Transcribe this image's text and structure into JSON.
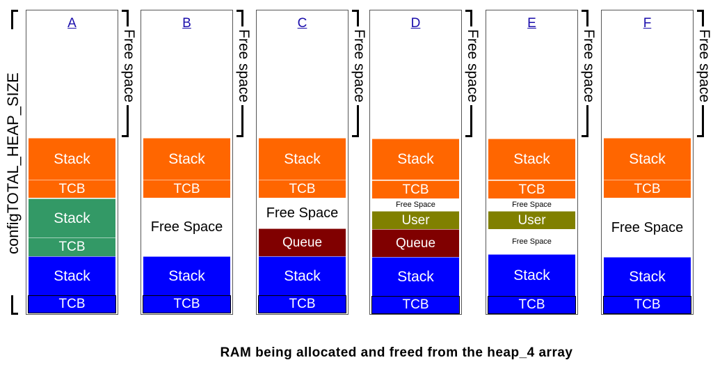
{
  "axis_label": "configTOTAL_HEAP_SIZE",
  "free_space_bracket_label": "Free space",
  "caption": "RAM being allocated and freed from the heap_4 array",
  "colors": {
    "task_orange": "#ff6600",
    "task_green": "#339966",
    "task_blue": "#0000ff",
    "queue": "#800000",
    "user": "#808000"
  },
  "columns": [
    {
      "label": "A",
      "blocks": [
        {
          "text": "Stack",
          "kind": "stack",
          "color": "#ff6600"
        },
        {
          "text": "TCB",
          "kind": "tcb",
          "color": "#ff6600"
        },
        {
          "text": "Stack",
          "kind": "stack",
          "color": "#339966"
        },
        {
          "text": "TCB",
          "kind": "tcb",
          "color": "#339966"
        },
        {
          "text": "Stack",
          "kind": "stack",
          "color": "#0000ff"
        },
        {
          "text": "TCB",
          "kind": "tcb",
          "color": "#0000ff"
        }
      ]
    },
    {
      "label": "B",
      "blocks": [
        {
          "text": "Stack",
          "kind": "stack",
          "color": "#ff6600"
        },
        {
          "text": "TCB",
          "kind": "tcb",
          "color": "#ff6600"
        },
        {
          "text": "Free Space",
          "kind": "free",
          "color": "#ffffff"
        },
        {
          "text": "Stack",
          "kind": "stack",
          "color": "#0000ff"
        },
        {
          "text": "TCB",
          "kind": "tcb",
          "color": "#0000ff"
        }
      ]
    },
    {
      "label": "C",
      "blocks": [
        {
          "text": "Stack",
          "kind": "stack",
          "color": "#ff6600"
        },
        {
          "text": "TCB",
          "kind": "tcb",
          "color": "#ff6600"
        },
        {
          "text": "Free Space",
          "kind": "free",
          "color": "#ffffff"
        },
        {
          "text": "Queue",
          "kind": "queue",
          "color": "#800000"
        },
        {
          "text": "Stack",
          "kind": "stack",
          "color": "#0000ff"
        },
        {
          "text": "TCB",
          "kind": "tcb",
          "color": "#0000ff"
        }
      ]
    },
    {
      "label": "D",
      "blocks": [
        {
          "text": "Stack",
          "kind": "stack",
          "color": "#ff6600"
        },
        {
          "text": "TCB",
          "kind": "tcb",
          "color": "#ff6600"
        },
        {
          "text": "Free Space",
          "kind": "free",
          "color": "#ffffff"
        },
        {
          "text": "User",
          "kind": "user",
          "color": "#808000"
        },
        {
          "text": "Queue",
          "kind": "queue",
          "color": "#800000"
        },
        {
          "text": "Stack",
          "kind": "stack",
          "color": "#0000ff"
        },
        {
          "text": "TCB",
          "kind": "tcb",
          "color": "#0000ff"
        }
      ]
    },
    {
      "label": "E",
      "blocks": [
        {
          "text": "Stack",
          "kind": "stack",
          "color": "#ff6600"
        },
        {
          "text": "TCB",
          "kind": "tcb",
          "color": "#ff6600"
        },
        {
          "text": "Free Space",
          "kind": "free",
          "color": "#ffffff"
        },
        {
          "text": "User",
          "kind": "user",
          "color": "#808000"
        },
        {
          "text": "Free Space",
          "kind": "free",
          "color": "#ffffff"
        },
        {
          "text": "Stack",
          "kind": "stack",
          "color": "#0000ff"
        },
        {
          "text": "TCB",
          "kind": "tcb",
          "color": "#0000ff"
        }
      ]
    },
    {
      "label": "F",
      "blocks": [
        {
          "text": "Stack",
          "kind": "stack",
          "color": "#ff6600"
        },
        {
          "text": "TCB",
          "kind": "tcb",
          "color": "#ff6600"
        },
        {
          "text": "Free Space",
          "kind": "free",
          "color": "#ffffff"
        },
        {
          "text": "Stack",
          "kind": "stack",
          "color": "#0000ff"
        },
        {
          "text": "TCB",
          "kind": "tcb",
          "color": "#0000ff"
        }
      ]
    }
  ]
}
